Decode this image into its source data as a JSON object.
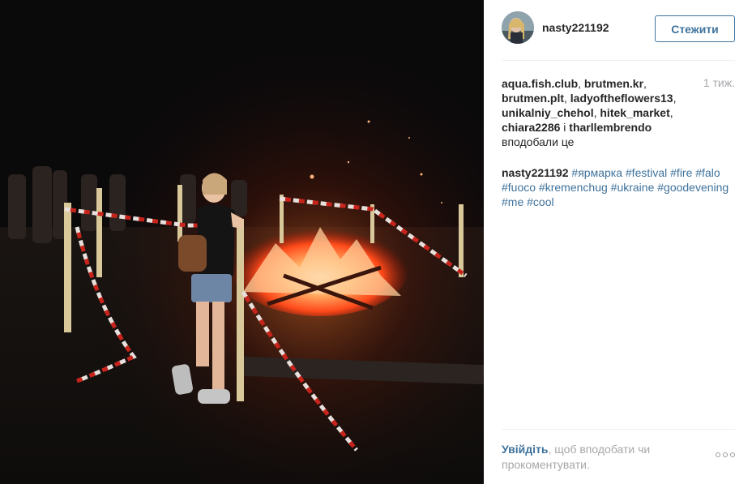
{
  "post": {
    "photo_icon": "bonfire-photo",
    "header": {
      "username": "nasty221192",
      "follow_label": "Стежити"
    },
    "likes": {
      "users": [
        "aqua.fish.club",
        "brutmen.kr",
        "brutmen.plt",
        "ladyoftheflowers13",
        "unikalniy_chehol",
        "hitek_market",
        "chiara2286",
        "tharllembrendo"
      ],
      "sep": ", ",
      "and": " і ",
      "suffix": " вподобали це"
    },
    "time_ago": "1 тиж.",
    "caption": {
      "author": "nasty221192",
      "hashtags": [
        "#ярмарка",
        "#festival",
        "#fire",
        "#falo",
        "#fuoco",
        "#kremenchug",
        "#ukraine",
        "#goodevening",
        "#me",
        "#cool"
      ]
    },
    "footer": {
      "login_link": "Увійдіть",
      "text": ", щоб вподобати чи прокоментувати."
    },
    "colors": {
      "link": "#3f729b",
      "text": "#262626",
      "muted": "#a5a7aa"
    }
  }
}
